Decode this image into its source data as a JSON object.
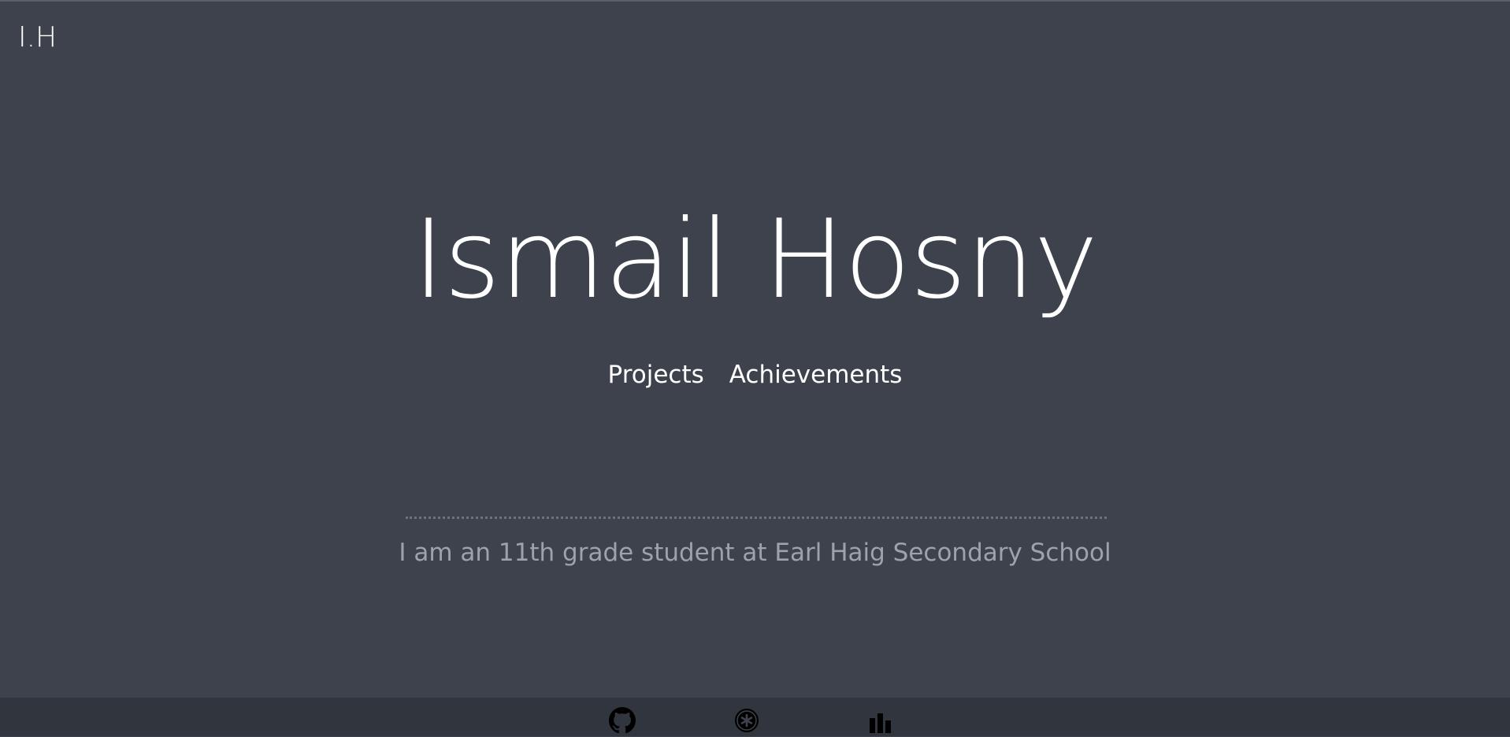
{
  "header": {
    "logo_text": "I.H"
  },
  "hero": {
    "title": "Ismail Hosny"
  },
  "nav": {
    "items": [
      {
        "label": "Projects"
      },
      {
        "label": "Achievements"
      }
    ]
  },
  "intro": {
    "tagline": "I am an 11th grade student at Earl Haig Secondary School"
  },
  "footer": {
    "icons": [
      {
        "name": "github-icon"
      },
      {
        "name": "asterisk-badge-icon"
      },
      {
        "name": "bar-chart-icon"
      }
    ]
  },
  "colors": {
    "background": "#3d424c",
    "footer_background": "#31353e",
    "text": "#ffffff",
    "muted_text": "#9da2ab"
  }
}
